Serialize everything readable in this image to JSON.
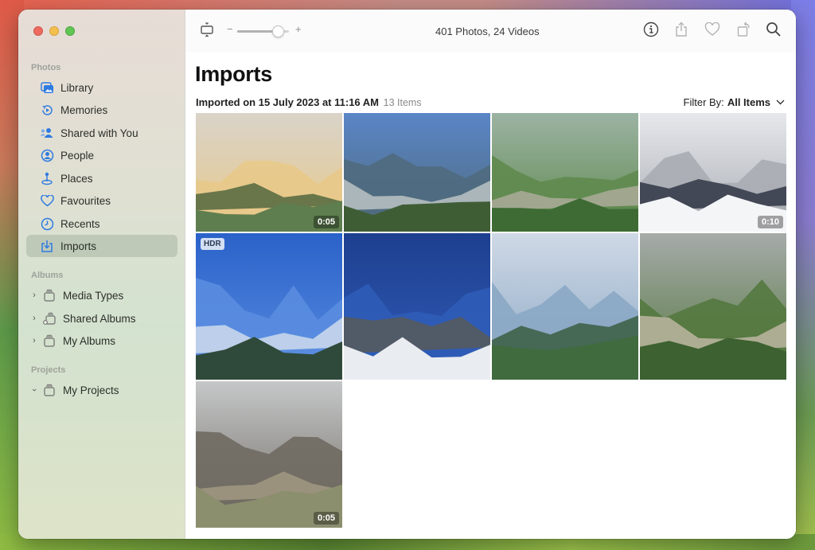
{
  "window": {
    "traffic_lights": [
      "close",
      "minimize",
      "maximize"
    ]
  },
  "sidebar": {
    "sections": [
      {
        "header": "Photos",
        "items": [
          {
            "label": "Library",
            "icon": "photo-library-icon"
          },
          {
            "label": "Memories",
            "icon": "memories-icon"
          },
          {
            "label": "Shared with You",
            "icon": "shared-with-you-icon"
          },
          {
            "label": "People",
            "icon": "people-icon"
          },
          {
            "label": "Places",
            "icon": "places-icon"
          },
          {
            "label": "Favourites",
            "icon": "heart-icon"
          },
          {
            "label": "Recents",
            "icon": "clock-icon"
          },
          {
            "label": "Imports",
            "icon": "import-icon",
            "selected": true
          }
        ]
      },
      {
        "header": "Albums",
        "items": [
          {
            "label": "Media Types",
            "icon": "album-stack-icon",
            "chevron": "right"
          },
          {
            "label": "Shared Albums",
            "icon": "shared-album-icon",
            "chevron": "right"
          },
          {
            "label": "My Albums",
            "icon": "album-stack-icon",
            "chevron": "right"
          }
        ]
      },
      {
        "header": "Projects",
        "items": [
          {
            "label": "My Projects",
            "icon": "album-stack-icon",
            "chevron": "down"
          }
        ]
      }
    ]
  },
  "toolbar": {
    "title": "401 Photos, 24 Videos",
    "zoom_minus": "−",
    "zoom_plus": "+",
    "zoom_level": 0.78,
    "icons": [
      "aspect-ratio-icon",
      "info-icon",
      "share-icon",
      "heart-icon",
      "rotate-icon",
      "search-icon"
    ]
  },
  "main": {
    "title": "Imports",
    "import_date": "Imported on 15 July 2023 at 11:16 AM",
    "item_count": "13 Items",
    "filter_label": "Filter By:",
    "filter_value": "All Items",
    "photos": [
      {
        "description": "snowy peaks at sunset with forest",
        "duration": "0:05",
        "palette": [
          "#d9d3c8",
          "#e8c98a",
          "#5f7e4f",
          "#3d5a33"
        ]
      },
      {
        "description": "river valley between forested mountains",
        "palette": [
          "#5a86c6",
          "#4f6a7e",
          "#3f5d35",
          "#c8cfcc"
        ]
      },
      {
        "description": "winding river through green hills",
        "palette": [
          "#9cb3a3",
          "#5f8a4e",
          "#3e6b34",
          "#b5b0a3"
        ]
      },
      {
        "description": "snow-covered slope with covered vehicle",
        "duration": "0:10",
        "palette": [
          "#e6e8ec",
          "#a8acb3",
          "#f4f5f7",
          "#1f2637"
        ]
      },
      {
        "description": "blue sky and snowy peak framed by pine",
        "badge": "HDR",
        "palette": [
          "#2a62c9",
          "#5a8de0",
          "#2f4a3a",
          "#dfe6ee"
        ]
      },
      {
        "description": "deep blue sky over snowy ridge",
        "palette": [
          "#1e3f8f",
          "#2f5cb7",
          "#e9ecf0",
          "#5e5a4c"
        ]
      },
      {
        "description": "cloudy sky over green mountains",
        "palette": [
          "#cfd9e6",
          "#8aa7c4",
          "#3f6b3e",
          "#2f5430"
        ]
      },
      {
        "description": "winding river in green valley",
        "palette": [
          "#a6aba9",
          "#54783f",
          "#3d6130",
          "#c9bfae"
        ]
      },
      {
        "description": "rocky peak above dry meadow",
        "duration": "0:05",
        "palette": [
          "#c5c7c8",
          "#6f6a62",
          "#8c8f6e",
          "#a89f86"
        ]
      }
    ]
  },
  "colors": {
    "accent": "#2b73d9",
    "selected_row": "#b9c7b4"
  }
}
